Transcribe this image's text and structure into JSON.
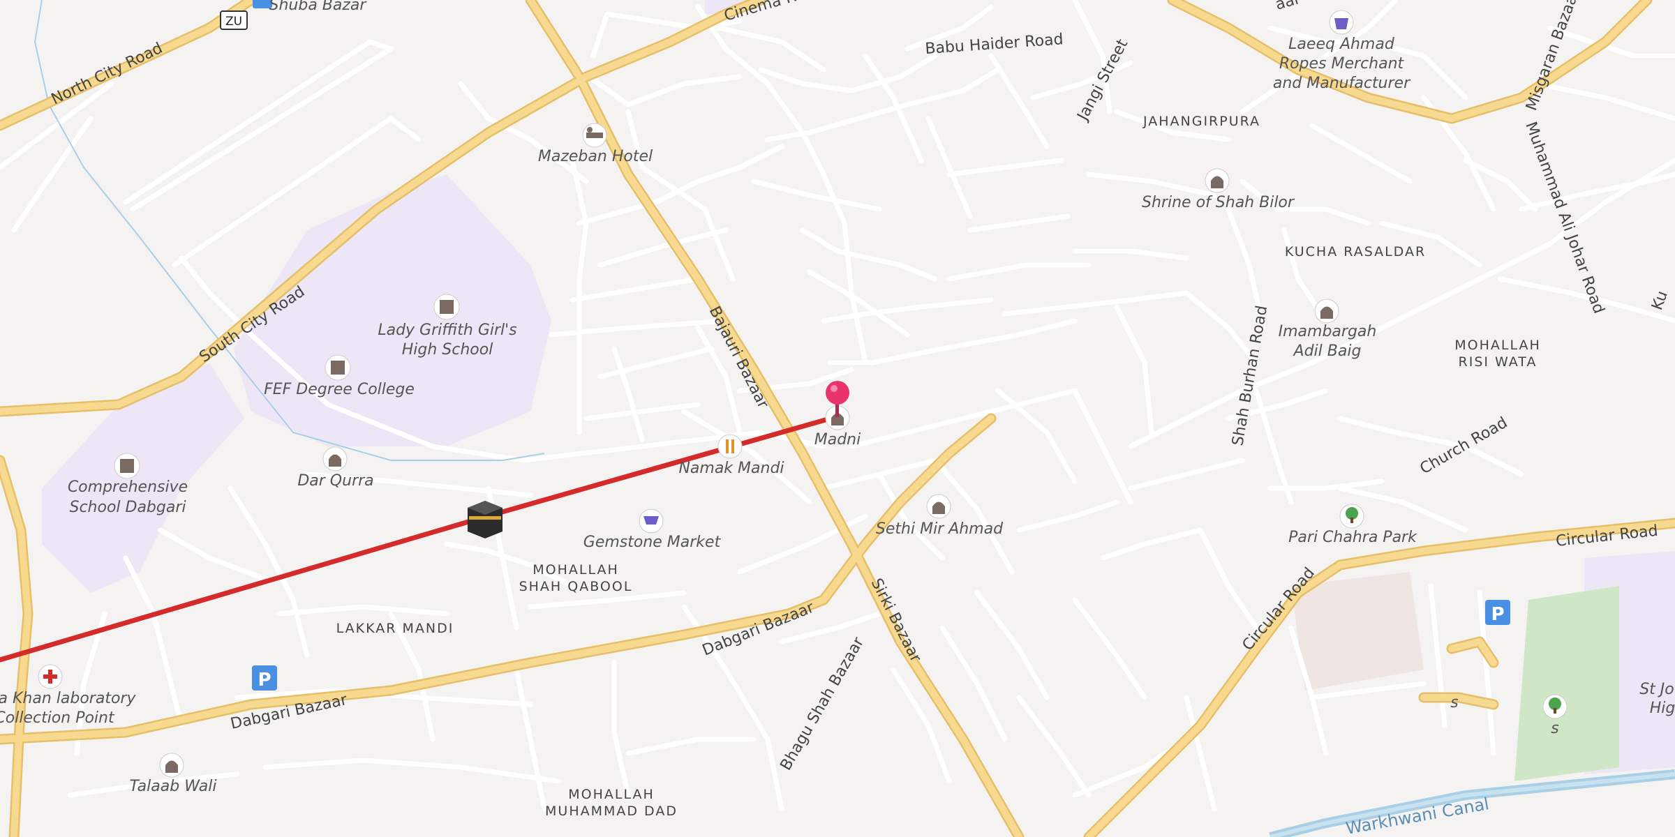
{
  "map": {
    "background": "#f5f3f1",
    "colors": {
      "minor_road": "#ffffff",
      "major_road_fill": "#f7d98f",
      "major_road_edge": "#e6bf6a",
      "school_area": "#ece6f6",
      "park_area": "#cfe6c7",
      "canal": "#a9cfe6",
      "route_line": "#d42a2a",
      "pin": "#e8336b",
      "poi_icon": "#7a6a61",
      "parking": "#4a90e2"
    },
    "route": {
      "start_icon": "kaaba-icon",
      "end_icon": "map-pin-icon"
    },
    "roads": {
      "north_city": "North City Road",
      "south_city": "South City Road",
      "bajauri": "Bajauri Bazaar",
      "sirki": "Sirki Bazaar",
      "dabgari_1": "Dabgari Bazaar",
      "dabgari_2": "Dabgari Bazaar",
      "bhagu": "Bhagu Shah Bazaar",
      "babu_haider": "Babu Haider Road",
      "cinema": "Cinema Road",
      "jangi": "Jangi Street",
      "shah_burhan": "Shah Burhan Road",
      "church": "Church Road",
      "circular_1": "Circular Road",
      "circular_2": "Circular Road",
      "muhammad_ali": "Muhammad Ali Johar Road",
      "misgaran": "Misgaran Bazaar",
      "canal": "Warkhwani Canal",
      "cut_top": "aar",
      "cut_right": "Ku"
    },
    "areas": {
      "jahangirpura": "JAHANGIRPURA",
      "kucha": "KUCHA RASALDAR",
      "risi_1": "MOHALLAH",
      "risi_2": "RISI WATA",
      "qabool_1": "MOHALLAH",
      "qabool_2": "SHAH QABOOL",
      "lakkar": "LAKKAR MANDI",
      "dad_1": "MOHALLAH",
      "dad_2": "MUHAMMAD DAD"
    },
    "pois": {
      "shuba": "Shuba Bazar",
      "bus_code": "ZU",
      "mazeban": "Mazeban Hotel",
      "laeeq_1": "Laeeq Ahmad",
      "laeeq_2": "Ropes Merchant",
      "laeeq_3": "and Manufacturer",
      "shrine": "Shrine of Shah Bilor",
      "imam_1": "Imambargah",
      "imam_2": "Adil Baig",
      "lady_1": "Lady Griffith Girl's",
      "lady_2": "High School",
      "fef": "FEF Degree College",
      "comp_1": "Comprehensive",
      "comp_2": "School Dabgari",
      "dar": "Dar Qurra",
      "madni": "Madni",
      "namak": "Namak Mandi",
      "gemstone": "Gemstone Market",
      "sethi": "Sethi Mir Ahmad",
      "pari": "Pari Chahra Park",
      "lab_1": "a Khan laboratory",
      "lab_2": "Collection Point",
      "talaab": "Talaab Wali",
      "stjo_1": "St Jo",
      "stjo_2": "Hig",
      "s1": "s",
      "s2": "s"
    }
  }
}
